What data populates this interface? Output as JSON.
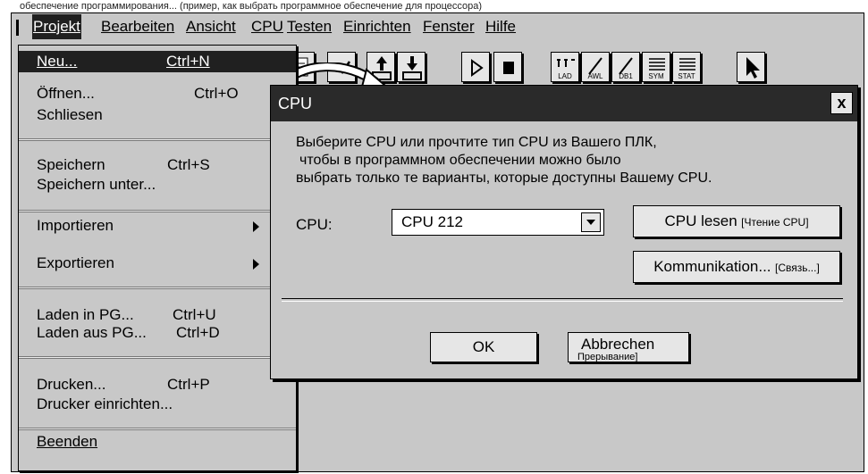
{
  "top_fragment": "обеспечение программирования... (пример, как выбрать программное обеспечение для процессора)",
  "menubar": {
    "items": [
      "Projekt",
      "Bearbeiten",
      "Ansicht",
      "CPU",
      "Testen",
      "Einrichten",
      "Fenster",
      "Hilfe"
    ],
    "active": "Projekt"
  },
  "dropdown": {
    "items": [
      {
        "label": "Neu...",
        "shortcut": "Ctrl+N",
        "highlight": true
      },
      {
        "label": "Öffnen...",
        "shortcut": "Ctrl+O"
      },
      {
        "label": "Schliesen"
      },
      {
        "label": "Speichern",
        "shortcut": "Ctrl+S"
      },
      {
        "label": "Speichern unter..."
      },
      {
        "label": "Importieren",
        "submenu": true
      },
      {
        "label": "Exportieren",
        "submenu": true
      },
      {
        "label": "Laden in PG...",
        "shortcut": "Ctrl+U"
      },
      {
        "label": "Laden aus PG...",
        "shortcut": "Ctrl+D"
      },
      {
        "label": "Drucken...",
        "shortcut": "Ctrl+P"
      },
      {
        "label": "Drucker einrichten..."
      },
      {
        "label": "Beenden"
      }
    ]
  },
  "toolbar": {
    "labels": [
      "LAD",
      "AWL",
      "DB1",
      "SYM",
      "STAT"
    ]
  },
  "dialog": {
    "title": "CPU",
    "message": [
      "Выберите CPU или прочтите тип CPU из Вашего ПЛК,",
      "чтобы в программном обеспечении можно было",
      "выбрать только те варианты, которые доступны Вашему CPU."
    ],
    "cpu_label": "CPU:",
    "cpu_value": "CPU 212",
    "btn_read": "CPU lesen",
    "btn_read_ru": "[Чтение CPU]",
    "btn_comm": "Kommunikation...",
    "btn_comm_ru": "[Связь...]",
    "btn_ok": "OK",
    "btn_cancel": "Abbrechen",
    "btn_cancel_ru": "Прерывание]"
  }
}
